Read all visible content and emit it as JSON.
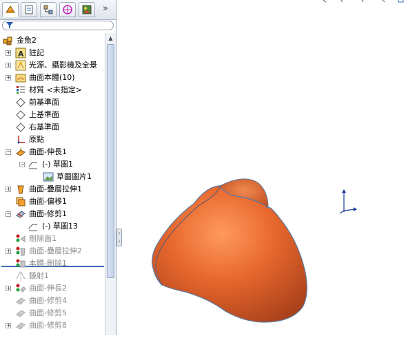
{
  "tree": {
    "root": "金魚2",
    "items": [
      {
        "label": "註記",
        "state": "normal"
      },
      {
        "label": "光源、攝影機及全景",
        "state": "normal"
      },
      {
        "label": "曲面本體(10)",
        "state": "normal"
      },
      {
        "label": "材質 <未指定>",
        "state": "normal"
      },
      {
        "label": "前基準面",
        "state": "normal"
      },
      {
        "label": "上基準面",
        "state": "normal"
      },
      {
        "label": "右基準面",
        "state": "normal"
      },
      {
        "label": "原點",
        "state": "normal"
      },
      {
        "label": "曲面-伸長1",
        "state": "normal"
      },
      {
        "label": "(-) 草圖1",
        "state": "normal"
      },
      {
        "label": "草圖圖片1",
        "state": "normal"
      },
      {
        "label": "曲面-疊層拉伸1",
        "state": "normal"
      },
      {
        "label": "曲面-偏移1",
        "state": "normal"
      },
      {
        "label": "曲面-修剪1",
        "state": "normal"
      },
      {
        "label": "(-) 草圖13",
        "state": "normal"
      },
      {
        "label": "刪除面1",
        "state": "suppressed"
      },
      {
        "label": "曲面-疊層拉伸2",
        "state": "suppressed"
      },
      {
        "label": "本體-刪除1",
        "state": "suppressed"
      },
      {
        "label": "鏡射1",
        "state": "suppressed"
      },
      {
        "label": "曲面-伸長2",
        "state": "suppressed"
      },
      {
        "label": "曲面-修剪4",
        "state": "suppressed"
      },
      {
        "label": "曲面-修剪5",
        "state": "suppressed"
      },
      {
        "label": "曲面-修剪8",
        "state": "suppressed"
      }
    ]
  },
  "colors": {
    "surface": "#e0632d",
    "surface_edge": "#5a7aa0",
    "rollback_bar": "#3c6eb4",
    "triad": "#1a3a9a"
  },
  "icons": {
    "tabs": [
      "feature-manager-icon",
      "property-manager-icon",
      "configuration-manager-icon",
      "dimxpert-icon",
      "display-manager-icon"
    ],
    "overflow": "»"
  }
}
